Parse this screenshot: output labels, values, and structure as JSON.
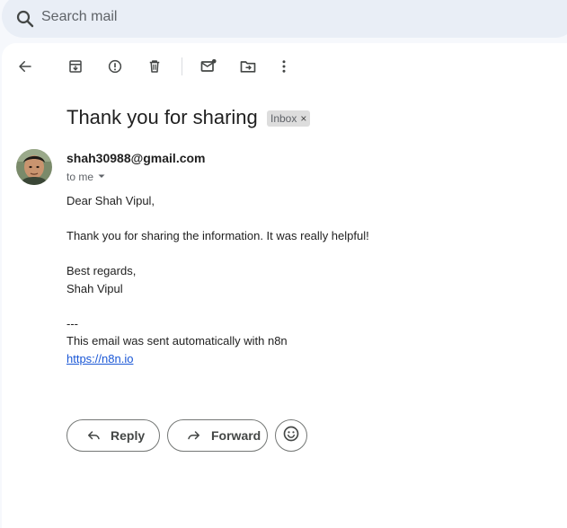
{
  "search": {
    "placeholder": "Search mail"
  },
  "email": {
    "subject": "Thank you for sharing",
    "label": "Inbox",
    "label_close": "×",
    "sender": "shah30988@gmail.com",
    "recipient": "to me",
    "body": {
      "greeting": "Dear Shah Vipul,",
      "paragraph": "Thank you for sharing the information. It was really helpful!",
      "closing": "Best regards,",
      "signature": "Shah Vipul",
      "separator": "---",
      "footer": "This email was sent automatically with n8n",
      "link": "https://n8n.io"
    }
  },
  "actions": {
    "reply": "Reply",
    "forward": "Forward"
  },
  "toolbar": {
    "icons": [
      "arrow-back-icon",
      "archive-icon",
      "report-spam-icon",
      "delete-icon",
      "mark-unread-icon",
      "move-to-icon",
      "more-vert-icon"
    ]
  },
  "colors": {
    "accent": "#1a57d6",
    "search_bg": "#e9eef6",
    "page_bg": "#f6f8fc"
  }
}
